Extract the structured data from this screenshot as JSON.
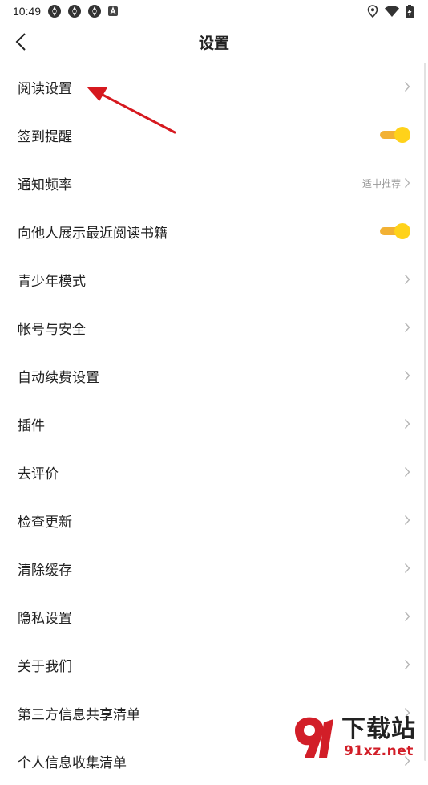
{
  "status_bar": {
    "time": "10:49",
    "notification_icons": [
      "app-notification-icon",
      "app-notification-icon",
      "app-notification-icon",
      "a-badge-icon"
    ],
    "right_icons": [
      "location-icon",
      "wifi-icon",
      "battery-charging-icon"
    ]
  },
  "header": {
    "title": "设置",
    "back_icon": "chevron-left-icon"
  },
  "settings": [
    {
      "label": "阅读设置",
      "type": "link"
    },
    {
      "label": "签到提醒",
      "type": "toggle",
      "on": true
    },
    {
      "label": "通知频率",
      "type": "link",
      "value": "适中推荐"
    },
    {
      "label": "向他人展示最近阅读书籍",
      "type": "toggle",
      "on": true
    },
    {
      "label": "青少年模式",
      "type": "link"
    },
    {
      "label": "帐号与安全",
      "type": "link"
    },
    {
      "label": "自动续费设置",
      "type": "link"
    },
    {
      "label": "插件",
      "type": "link"
    },
    {
      "label": "去评价",
      "type": "link"
    },
    {
      "label": "检查更新",
      "type": "link"
    },
    {
      "label": "清除缓存",
      "type": "link"
    },
    {
      "label": "隐私设置",
      "type": "link"
    },
    {
      "label": "关于我们",
      "type": "link"
    },
    {
      "label": "第三方信息共享清单",
      "type": "link"
    },
    {
      "label": "个人信息收集清单",
      "type": "link"
    }
  ],
  "colors": {
    "toggle_track": "#f2b134",
    "toggle_knob": "#ffd21a",
    "annotation_arrow": "#d6191f",
    "watermark_red": "#d21e28"
  },
  "watermark": {
    "title": "下载站",
    "site": "91xz.net"
  }
}
